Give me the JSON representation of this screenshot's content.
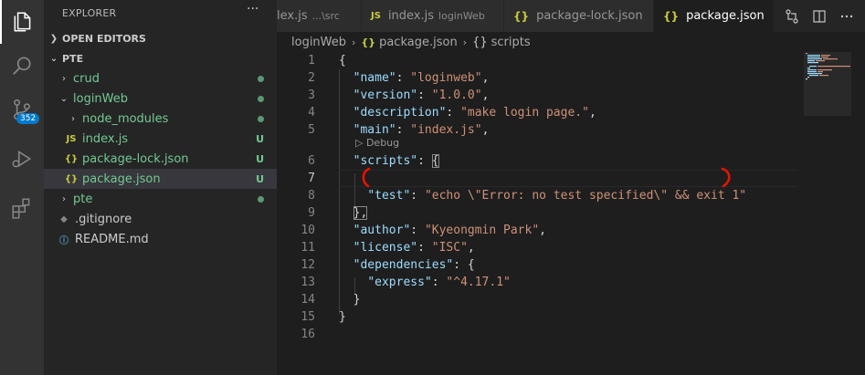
{
  "sidebar": {
    "title": "EXPLORER",
    "more": "···",
    "open_editors": "OPEN EDITORS",
    "root": "PTE",
    "items": [
      {
        "label": "crud",
        "status": ""
      },
      {
        "label": "loginWeb",
        "status": ""
      },
      {
        "label": "node_modules",
        "status": ""
      },
      {
        "label": "index.js",
        "status": "U",
        "icon": "JS"
      },
      {
        "label": "package-lock.json",
        "status": "U",
        "icon": "{}"
      },
      {
        "label": "package.json",
        "status": "U",
        "icon": "{}"
      },
      {
        "label": "pte",
        "status": ""
      },
      {
        "label": ".gitignore",
        "status": ""
      },
      {
        "label": "README.md",
        "status": ""
      }
    ]
  },
  "activity": {
    "scm_badge": "352"
  },
  "tabs": [
    {
      "label": "lex.js",
      "desc": "...\\src"
    },
    {
      "label": "index.js",
      "desc": "loginWeb",
      "icon": "JS"
    },
    {
      "label": "package-lock.json",
      "desc": "",
      "icon": "{}"
    },
    {
      "label": "package.json",
      "desc": "",
      "icon": "{}",
      "active": true,
      "close": "×"
    }
  ],
  "breadcrumb": {
    "folder": "loginWeb",
    "file": "package.json",
    "symbol": "scripts",
    "symbol_icon": "{}"
  },
  "codelens": "▷ Debug",
  "code": {
    "l1": "{",
    "l2_key": "\"name\"",
    "l2_val": "\"loginweb\"",
    "l3_key": "\"version\"",
    "l3_val": "\"1.0.0\"",
    "l4_key": "\"description\"",
    "l4_val": "\"make login page.\"",
    "l5_key": "\"main\"",
    "l5_val": "\"index.js\"",
    "l6_key": "\"scripts\"",
    "l6_brace": "{",
    "l8_key": "\"test\"",
    "l8_val": "\"echo \\\"Error: no test specified\\\" && exit 1\"",
    "l9": "},",
    "l10_key": "\"author\"",
    "l10_val": "\"Kyeongmin Park\"",
    "l11_key": "\"license\"",
    "l11_val": "\"ISC\"",
    "l12_key": "\"dependencies\"",
    "l12_brace": "{",
    "l13_key": "\"express\"",
    "l13_val": "\"^4.17.1\"",
    "l14": "}",
    "l15": "}"
  },
  "line_numbers": [
    "1",
    "2",
    "3",
    "4",
    "5",
    "6",
    "7",
    "8",
    "9",
    "10",
    "11",
    "12",
    "13",
    "14",
    "15",
    "16"
  ],
  "colors": {
    "accent": "#007acc",
    "annotation": "#e51400",
    "untracked": "#73c991",
    "json_icon": "#cbcb41"
  }
}
